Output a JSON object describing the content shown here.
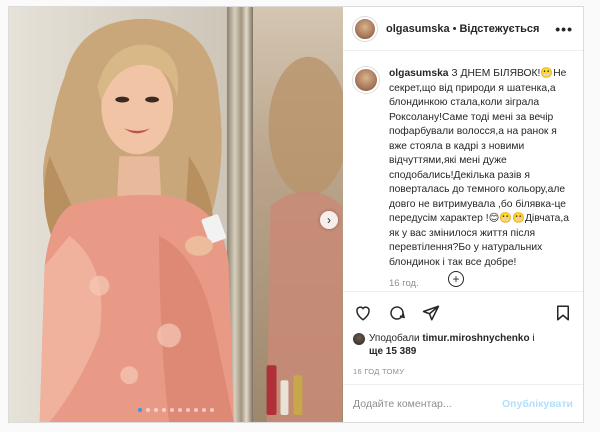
{
  "header": {
    "username": "olgasumska",
    "separator": "•",
    "follow_label": "Відстежується",
    "more_label": "•••"
  },
  "caption": {
    "username": "olgasumska",
    "text_1": " З ДНЕМ БІЛЯВОК!",
    "text_2": "Не секрет,що від природи я шатенка,а блондинкою стала,коли зіграла Роксолану!Саме тоді мені за вечір пофарбували волосся,а на ранок я вже стояла в кадрі з новими відчуттями,які мені дуже сподобались!Декілька разів я поверталась до темного кольору,але довго не витримувала ,бо білявка-це передусім характер !",
    "text_3": "Дівчата,а як у вас змінилося життя після перевтілення?Бо у натуральних блондинок і так все добре!",
    "time": "16 год."
  },
  "likes": {
    "prefix": "Уподобали ",
    "user": "timur.miroshnychenko",
    "middle": " і",
    "more_prefix": "ще ",
    "count": "15 389"
  },
  "timestamp": "16 год тому",
  "comment_input": {
    "placeholder": "Додайте коментар..."
  },
  "publish_label": "Опублікувати",
  "carousel": {
    "total": 10,
    "active_index": 0
  },
  "colors": {
    "accent": "#3897f0",
    "publish_disabled": "#b2dffc",
    "muted": "#8e8e8e"
  },
  "icons": [
    "heart-icon",
    "comment-icon",
    "share-icon",
    "bookmark-icon",
    "plus-circle-icon",
    "chevron-right-icon"
  ]
}
